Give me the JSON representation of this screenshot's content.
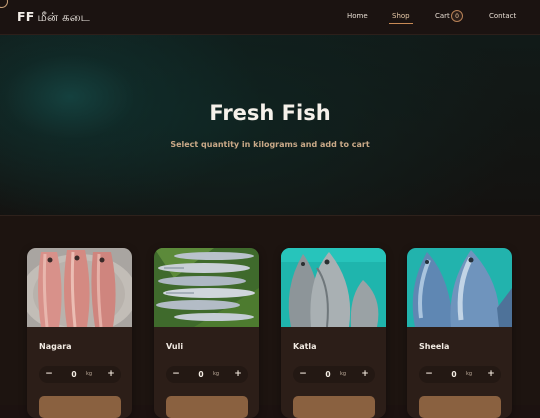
{
  "nav": {
    "brand_latin": "FF",
    "brand_tamil": "மீன் கடை",
    "links": [
      "Home",
      "Shop",
      "Cart",
      "Contact"
    ],
    "active": "Shop",
    "cart_count": "0"
  },
  "hero": {
    "title": "Fresh Fish",
    "subtitle": "Select quantity in kilograms and add to cart"
  },
  "products": [
    {
      "name": "Nagara",
      "qty": "0",
      "unit": "kg",
      "image": "nagara-photo"
    },
    {
      "name": "Vuli",
      "qty": "0",
      "unit": "kg",
      "image": "vuli-photo"
    },
    {
      "name": "Katla",
      "qty": "0",
      "unit": "kg",
      "image": "katla-photo"
    },
    {
      "name": "Sheela",
      "qty": "0",
      "unit": "kg",
      "image": "sheela-photo"
    }
  ],
  "stepper": {
    "minus": "−",
    "plus": "+"
  },
  "colors": {
    "background": "#1c1210",
    "card": "#2c1e18",
    "accent": "#c88a55",
    "add_button": "#8a6140",
    "subtitle": "#c9a988",
    "hero_teal": "#164e4c"
  }
}
